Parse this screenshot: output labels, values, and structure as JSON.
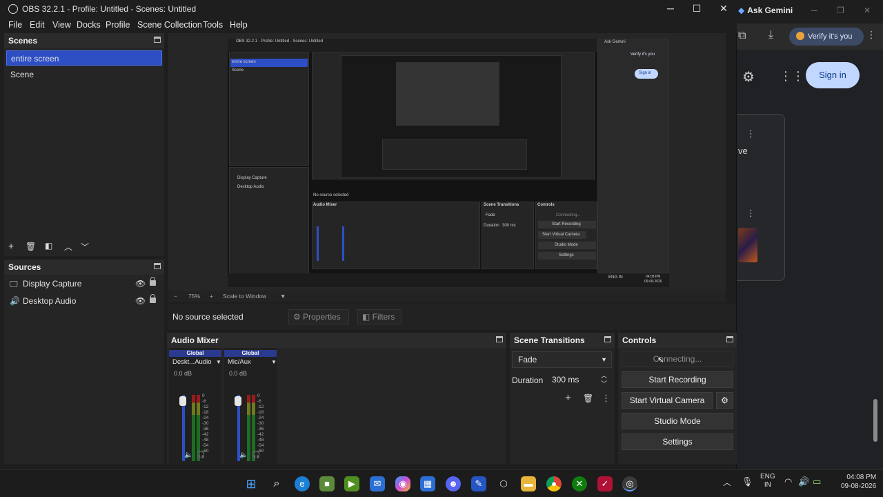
{
  "titlebar": {
    "title": "OBS 32.2.1 - Profile: Untitled - Scenes: Untitled",
    "minimize": "─",
    "maximize": "☐",
    "close": "✕"
  },
  "menu": [
    "File",
    "Edit",
    "View",
    "Docks",
    "Profile",
    "Scene Collection",
    "Tools",
    "Help"
  ],
  "scenes": {
    "title": "Scenes",
    "items": [
      "entire screen",
      "Scene"
    ],
    "selected_index": 0
  },
  "sources": {
    "title": "Sources",
    "items": [
      {
        "label": "Display Capture",
        "icon": "monitor-icon"
      },
      {
        "label": "Desktop Audio",
        "icon": "speaker-icon"
      }
    ]
  },
  "preview": {
    "zoom_label": "75%",
    "scale_label": "Scale to Window",
    "mini_title": "OBS 32.2.1 - Profile: Untitled - Scenes: Untitled",
    "mini_scene_sel": "entire screen",
    "mini_scene_2": "Scene",
    "mini_src_1": "Display Capture",
    "mini_src_2": "Desktop Audio",
    "mini_nosrc": "No source selected",
    "mini_mixer": "Audio Mixer",
    "mini_transitions": "Scene Transitions",
    "mini_controls": "Controls",
    "mini_fade": "Fade",
    "mini_duration": "Duration",
    "mini_ms": "300 ms",
    "mini_connecting": "Connecting...",
    "mini_start_rec": "Start Recording",
    "mini_start_vc": "Start Virtual Camera",
    "mini_studio": "Studio Mode",
    "mini_settings": "Settings",
    "mini_gemini": "Ask Gemini",
    "mini_verify": "Verify it's you",
    "mini_signin": "Sign in",
    "mini_time": "04:08 PM",
    "mini_date": "09-08-2026",
    "mini_lang": "ENG IN"
  },
  "selection_bar": {
    "no_source": "No source selected",
    "properties": "Properties",
    "filters": "Filters"
  },
  "audio_mixer": {
    "title": "Audio Mixer",
    "channels": [
      {
        "group": "Global",
        "name": "Deskt...Audio",
        "level": "0.0 dB"
      },
      {
        "group": "Global",
        "name": "Mic/Aux",
        "level": "0.0 dB"
      }
    ],
    "scale": [
      "0",
      "-6",
      "-12",
      "-18",
      "-24",
      "-30",
      "-36",
      "-42",
      "-48",
      "-54",
      "-60"
    ]
  },
  "scene_transitions": {
    "title": "Scene Transitions",
    "transition": "Fade",
    "duration_label": "Duration",
    "duration_value": "300 ms"
  },
  "controls": {
    "title": "Controls",
    "connecting": "Connecting...",
    "start_recording": "Start Recording",
    "start_virtual_camera": "Start Virtual Camera",
    "studio_mode": "Studio Mode",
    "settings": "Settings"
  },
  "browser": {
    "tab_title": "Ask Gemini",
    "verify": "Verify it's you",
    "sign_in": "Sign in",
    "partial_text": "ve"
  },
  "taskbar": {
    "lang_line1": "ENG",
    "lang_line2": "IN",
    "time": "04:08 PM",
    "date": "09-08-2026"
  }
}
